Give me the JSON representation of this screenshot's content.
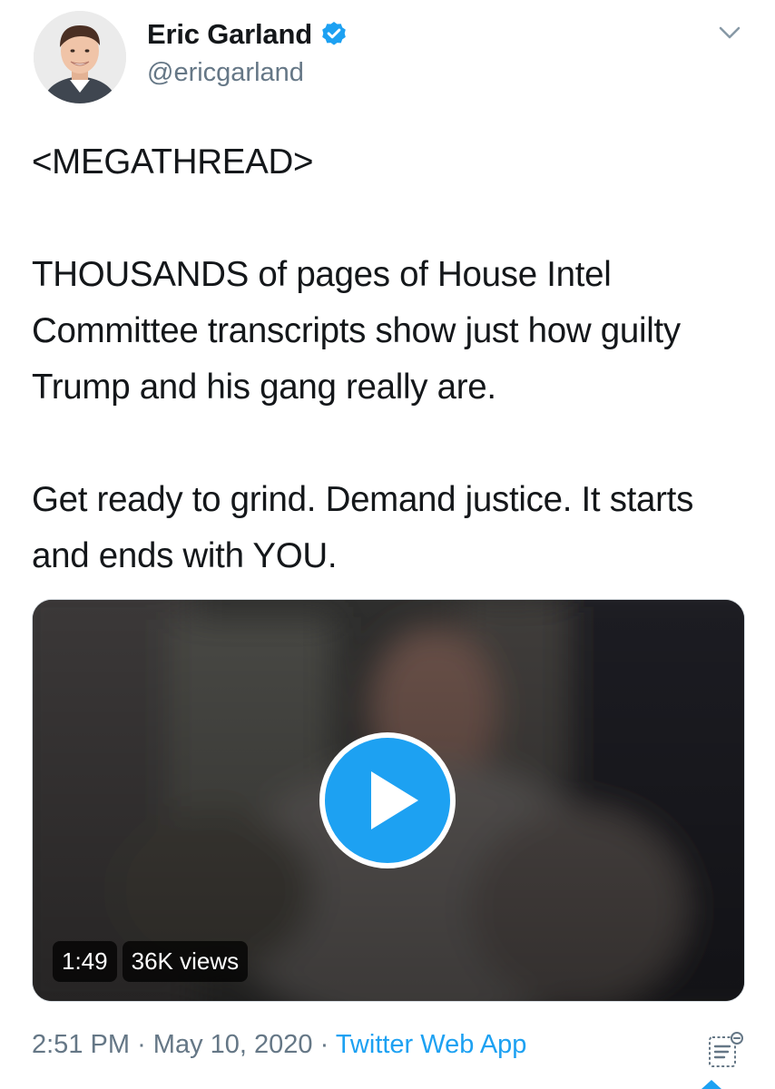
{
  "author": {
    "display_name": "Eric Garland",
    "handle": "@ericgarland",
    "verified": true,
    "avatar_icon": "profile-photo"
  },
  "tweet": {
    "paragraphs": [
      "<MEGATHREAD>",
      "THOUSANDS of pages of House Intel Committee transcripts show just how guilty Trump and his gang really are.",
      "Get ready to grind. Demand justice. It starts and ends with YOU."
    ]
  },
  "video": {
    "duration": "1:49",
    "views": "36K views",
    "play_icon": "play-icon"
  },
  "meta": {
    "time": "2:51 PM",
    "separator": "·",
    "date": "May 10, 2020",
    "source": "Twitter Web App"
  },
  "icons": {
    "verified": "verified-badge-icon",
    "more": "chevron-down-icon",
    "analytics": "analytics-icon"
  },
  "colors": {
    "accent": "#1da1f2",
    "text": "#14171a",
    "secondary_text": "#657786",
    "border": "#d7dde2"
  }
}
